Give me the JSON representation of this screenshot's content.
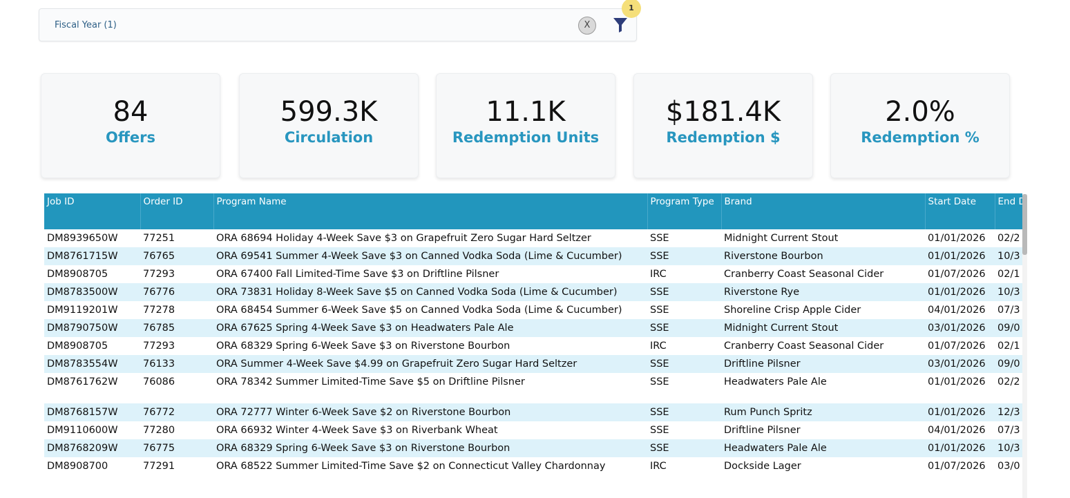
{
  "filter": {
    "label": "Fiscal Year (1)",
    "clear_label": "X",
    "badge_count": "1"
  },
  "kpis": [
    {
      "value": "84",
      "label": "Offers"
    },
    {
      "value": "599.3K",
      "label": "Circulation"
    },
    {
      "value": "11.1K",
      "label": "Redemption Units"
    },
    {
      "value": "$181.4K",
      "label": "Redemption $"
    },
    {
      "value": "2.0%",
      "label": "Redemption %"
    }
  ],
  "table": {
    "columns": [
      "Job ID",
      "Order ID",
      "Program Name",
      "Program Type",
      "Brand",
      "Start Date",
      "End D"
    ],
    "rows": [
      [
        "DM8939650W",
        "77251",
        "ORA 68694 Holiday 4-Week Save $3 on Grapefruit Zero Sugar Hard Seltzer",
        "SSE",
        "Midnight Current Stout",
        "01/01/2026",
        "02/2"
      ],
      [
        "DM8761715W",
        "76765",
        "ORA 69541 Summer 4-Week Save $3 on Canned Vodka Soda (Lime & Cucumber)",
        "SSE",
        "Riverstone Bourbon",
        "01/01/2026",
        "10/3"
      ],
      [
        "DM8908705",
        "77293",
        "ORA 67400 Fall Limited-Time Save $3 on Driftline Pilsner",
        "IRC",
        "Cranberry Coast Seasonal Cider",
        "01/07/2026",
        "02/1"
      ],
      [
        "DM8783500W",
        "76776",
        "ORA 73831 Holiday 8-Week Save $5 on Canned Vodka Soda (Lime & Cucumber)",
        "SSE",
        "Riverstone Rye",
        "01/01/2026",
        "10/3"
      ],
      [
        "DM9119201W",
        "77278",
        "ORA 68454 Summer 6-Week Save $5 on Canned Vodka Soda (Lime & Cucumber)",
        "SSE",
        "Shoreline Crisp Apple Cider",
        "04/01/2026",
        "07/3"
      ],
      [
        "DM8790750W",
        "76785",
        "ORA 67625 Spring 4-Week Save $3 on Headwaters Pale Ale",
        "SSE",
        "Midnight Current Stout",
        "03/01/2026",
        "09/0"
      ],
      [
        "DM8908705",
        "77293",
        "ORA 68329 Spring 6-Week Save $3 on Riverstone Bourbon",
        "IRC",
        "Cranberry Coast Seasonal Cider",
        "01/07/2026",
        "02/1"
      ],
      [
        "DM8783554W",
        "76133",
        "ORA Summer 4-Week Save $4.99 on Grapefruit Zero Sugar Hard Seltzer",
        "SSE",
        "Driftline Pilsner",
        "03/01/2026",
        "09/0"
      ],
      [
        "DM8761762W",
        "76086",
        "ORA 78342 Summer Limited-Time Save $5 on Driftline Pilsner",
        "SSE",
        "Headwaters Pale Ale",
        "01/01/2026",
        "02/2"
      ],
      [
        "DM8768157W",
        "76772",
        "ORA 72777 Winter 6-Week Save $2 on Riverstone Bourbon",
        "SSE",
        "Rum Punch Spritz",
        "01/01/2026",
        "12/3"
      ],
      [
        "DM9110600W",
        "77280",
        "ORA 66932 Winter 4-Week Save $3 on Riverbank Wheat",
        "SSE",
        "Driftline Pilsner",
        "04/01/2026",
        "07/3"
      ],
      [
        "DM8768209W",
        "76775",
        "ORA 68329 Spring 6-Week Save $3 on Riverstone Bourbon",
        "SSE",
        "Headwaters Pale Ale",
        "01/01/2026",
        "10/3"
      ],
      [
        "DM8908700",
        "77291",
        "ORA 68522 Summer Limited-Time Save $2 on Connecticut Valley Chardonnay",
        "IRC",
        "Dockside Lager",
        "01/07/2026",
        "03/0"
      ]
    ]
  }
}
